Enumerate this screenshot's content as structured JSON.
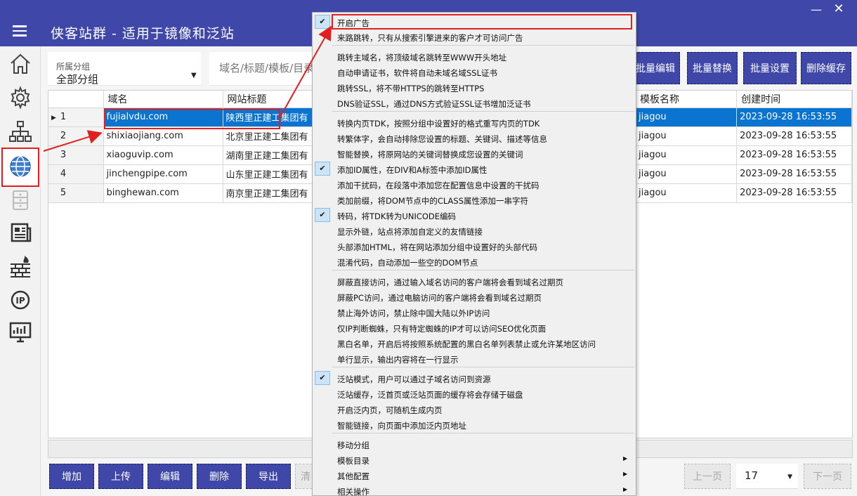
{
  "app": {
    "title": "侠客站群 - 适用于镜像和泛站",
    "minimize": "—",
    "close": "✕"
  },
  "toolbar": {
    "group_label": "所属分组",
    "group_value": "全部分组",
    "search_placeholder": "域名/标题/模板/目录",
    "buttons": [
      "批量编辑",
      "批量替换",
      "批量设置",
      "删除缓存"
    ]
  },
  "grid": {
    "columns": [
      "域名",
      "网站标题",
      "模板名称",
      "创建时间"
    ],
    "rows": [
      {
        "no": "1",
        "domain": "fujialvdu.com",
        "title": "陕西里正建工集团有",
        "template": "jiagou",
        "created": "2023-09-28 16:53:55"
      },
      {
        "no": "2",
        "domain": "shixiaojiang.com",
        "title": "北京里正建工集团有",
        "template": "jiagou",
        "created": "2023-09-28 16:53:55"
      },
      {
        "no": "3",
        "domain": "xiaoguvip.com",
        "title": "湖南里正建工集团有",
        "template": "jiagou",
        "created": "2023-09-28 16:53:55"
      },
      {
        "no": "4",
        "domain": "jinchengpipe.com",
        "title": "山东里正建工集团有",
        "template": "jiagou",
        "created": "2023-09-28 16:53:55"
      },
      {
        "no": "5",
        "domain": "binghewan.com",
        "title": "南京里正建工集团有",
        "template": "jiagou",
        "created": "2023-09-28 16:53:55"
      }
    ]
  },
  "bottom": {
    "buttons": [
      "增加",
      "上传",
      "编辑",
      "删除",
      "导出",
      "清"
    ],
    "prev": "上一页",
    "page": "17",
    "next": "下一页"
  },
  "sidebar": {
    "items": [
      "home-icon",
      "settings-gear-icon",
      "sitemap-tree-icon",
      "globe-icon",
      "server-icon",
      "article-icon",
      "firewall-icon",
      "ip-icon",
      "monitor-chart-icon"
    ]
  },
  "menu": {
    "items": [
      {
        "label": "开启广告",
        "checked": true,
        "highlighted": true
      },
      {
        "label": "来路跳转，只有从搜索引擎进来的客户才可访问广告",
        "checked": false
      },
      {
        "label": "跳转主域名，将顶级域名跳转至WWW开头地址",
        "checked": false
      },
      {
        "label": "自动申请证书，软件将自动未域名域SSL证书",
        "checked": false
      },
      {
        "label": "跳转SSL，将不带HTTPS的跳转至HTTPS",
        "checked": false
      },
      {
        "label": "DNS验证SSL，通过DNS方式验证SSL证书增加泛证书",
        "checked": false
      },
      {
        "label": "转换内页TDK，按照分组中设置好的格式重写内页的TDK",
        "checked": false
      },
      {
        "label": "转繁体字，会自动排除您设置的标题、关键词、描述等信息",
        "checked": false
      },
      {
        "label": "智能替换，将原网站的关键词替换成您设置的关键词",
        "checked": false
      },
      {
        "label": "添加ID属性，在DIV和A标签中添加ID属性",
        "checked": true
      },
      {
        "label": "添加干扰码，在段落中添加您在配置信息中设置的干扰码",
        "checked": false
      },
      {
        "label": "类加前缀，将DOM节点中的CLASS属性添加一串字符",
        "checked": false
      },
      {
        "label": "转码，将TDK转为UNICODE编码",
        "checked": true
      },
      {
        "label": "显示外链，站点将添加自定义的友情链接",
        "checked": false
      },
      {
        "label": "头部添加HTML，将在网站添加分组中设置好的头部代码",
        "checked": false
      },
      {
        "label": "混淆代码，自动添加一些空的DOM节点",
        "checked": false
      },
      {
        "label": "屏蔽直接访问，通过输入域名访问的客户端将会看到域名过期页",
        "checked": false
      },
      {
        "label": "屏蔽PC访问，通过电脑访问的客户端将会看到域名过期页",
        "checked": false
      },
      {
        "label": "禁止海外访问，禁止除中国大陆以外IP访问",
        "checked": false
      },
      {
        "label": "仅IP判断蜘蛛，只有特定蜘蛛的IP才可以访问SEO优化页面",
        "checked": false
      },
      {
        "label": "黑白名单，开启后将按照系统配置的黑白名单列表禁止或允许某地区访问",
        "checked": false
      },
      {
        "label": "单行显示，输出内容将在一行显示",
        "checked": false
      },
      {
        "label": "泛站模式，用户可以通过子域名访问到资源",
        "checked": true
      },
      {
        "label": "泛站缓存，泛首页或泛站页面的缓存将会存储于磁盘",
        "checked": false
      },
      {
        "label": "开启泛内页，可随机生成内页",
        "checked": false
      },
      {
        "label": "智能链接，向页面中添加泛内页地址",
        "checked": false
      },
      {
        "label": "移动分组",
        "checked": false
      },
      {
        "label": "模板目录",
        "checked": false,
        "submenu": true
      },
      {
        "label": "其他配置",
        "checked": false,
        "submenu": true
      },
      {
        "label": "相关操作",
        "checked": false,
        "submenu": true
      }
    ]
  },
  "colors": {
    "titlebar": "#3f48a8",
    "selected_row": "#0a74d0",
    "highlight_border": "#e02020"
  }
}
